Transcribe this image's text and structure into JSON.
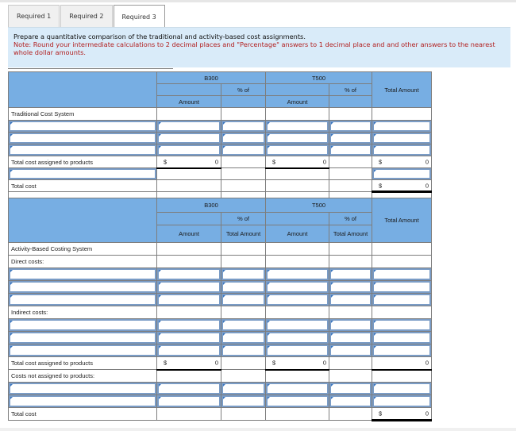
{
  "tabs": [
    {
      "label": "Required 1",
      "active": false
    },
    {
      "label": "Required 2",
      "active": false
    },
    {
      "label": "Required 3",
      "active": true
    }
  ],
  "instructions": {
    "main": "Prepare a quantitative comparison of the traditional and activity-based cost assignments.",
    "note": "Note: Round your intermediate calculations to 2 decimal places and \"Percentage\" answers to 1 decimal place and and other answers to the nearest whole dollar amounts."
  },
  "traditional": {
    "header": {
      "product1": "B300",
      "product2": "T500",
      "pct_of": "% of",
      "amount": "Amount",
      "total_amount": "Total Amount"
    },
    "section_label": "Traditional Cost System",
    "total_assigned_label": "Total cost assigned to products",
    "total_cost_label": "Total cost",
    "currency": "$",
    "b300_total_assigned": "0",
    "t500_total_assigned": "0",
    "grand_total_assigned": "0",
    "total_cost": "0"
  },
  "abc": {
    "header": {
      "product1": "B300",
      "product2": "T500",
      "pct_of": "% of",
      "pct_total_amount": "Total Amount",
      "amount": "Amount",
      "total_amount": "Total Amount"
    },
    "section_label": "Activity-Based Costing System",
    "direct_label": "Direct costs:",
    "indirect_label": "Indirect costs:",
    "total_assigned_label": "Total cost assigned to products",
    "not_assigned_label": "Costs not assigned to products:",
    "total_cost_label": "Total cost",
    "currency": "$",
    "b300_total_assigned": "0",
    "t500_total_assigned": "0",
    "grand_total_assigned": "0",
    "total_cost": "0"
  }
}
